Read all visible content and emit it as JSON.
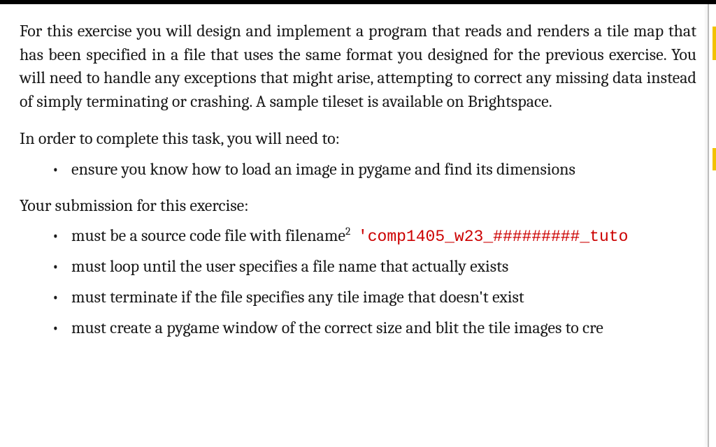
{
  "intro": "For this exercise you will design and implement a program that reads and renders a tile map that has been specified in a file that uses the same format you designed for the previous exercise. You will need to handle any exceptions that might arise, attempting to correct any missing data instead of simply terminating or crashing. A sample tileset is available on Brightspace.",
  "task_lead": "In order to complete this task, you will need to:",
  "task_items": [
    "ensure you know how to load an image in pygame and find its dimensions"
  ],
  "submission_lead": "Your submission for this exercise:",
  "submission_items": [
    {
      "prefix": "must be a source code file with filename",
      "sup": "2",
      "code": "'comp1405_w23_#########_tuto"
    },
    {
      "prefix": "must loop until the user specifies a file name that actually exists",
      "sup": "",
      "code": ""
    },
    {
      "prefix": "must terminate if the file specifies any tile image that doesn't exist",
      "sup": "",
      "code": ""
    },
    {
      "prefix": "must create a pygame window of the correct size and blit the tile images to cre",
      "sup": "",
      "code": ""
    }
  ]
}
